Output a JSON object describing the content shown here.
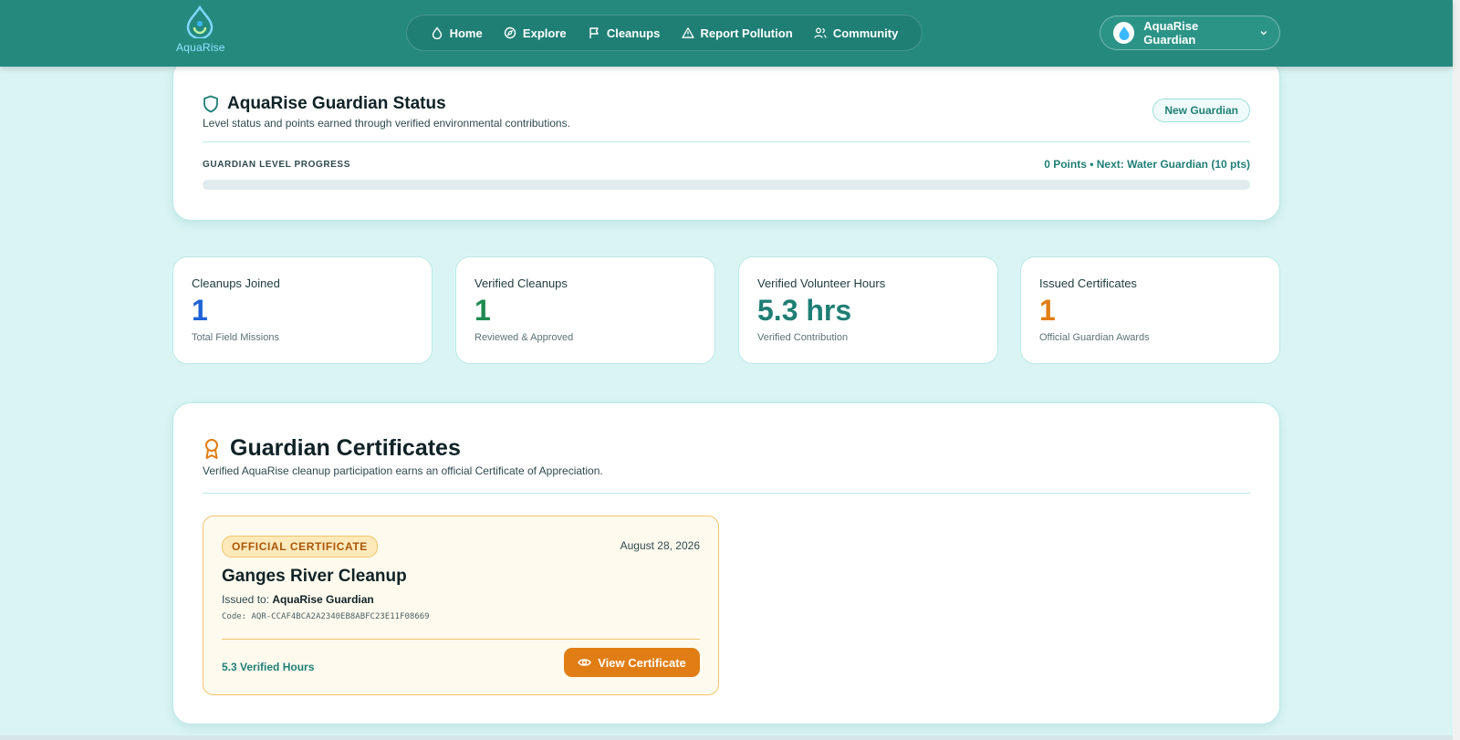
{
  "brand": {
    "name": "AquaRise"
  },
  "nav": {
    "items": [
      {
        "label": "Home",
        "icon": "droplet-icon"
      },
      {
        "label": "Explore",
        "icon": "compass-icon"
      },
      {
        "label": "Cleanups",
        "icon": "flag-icon"
      },
      {
        "label": "Report Pollution",
        "icon": "warning-triangle-icon"
      },
      {
        "label": "Community",
        "icon": "users-icon"
      }
    ]
  },
  "user": {
    "name": "AquaRise Guardian",
    "icon": "chevron-down-icon"
  },
  "status": {
    "title": "AquaRise Guardian Status",
    "subtitle": "Level status and points earned through verified environmental contributions.",
    "badge": "New Guardian",
    "progress_label": "GUARDIAN LEVEL PROGRESS",
    "progress_text": "0 Points • Next: Water Guardian (10 pts)",
    "progress_fraction": 0
  },
  "stats": [
    {
      "label": "Cleanups Joined",
      "value": "1",
      "caption": "Total Field Missions",
      "color": "#1e63d6"
    },
    {
      "label": "Verified Cleanups",
      "value": "1",
      "caption": "Reviewed & Approved",
      "color": "#1f8a52"
    },
    {
      "label": "Verified Volunteer Hours",
      "value": "5.3 hrs",
      "caption": "Verified Contribution",
      "color": "#1f7f75"
    },
    {
      "label": "Issued Certificates",
      "value": "1",
      "caption": "Official Guardian Awards",
      "color": "#e07d14"
    }
  ],
  "certificates": {
    "title": "Guardian Certificates",
    "subtitle": "Verified AquaRise cleanup participation earns an official Certificate of Appreciation.",
    "items": [
      {
        "badge": "OFFICIAL CERTIFICATE",
        "date": "August 28, 2026",
        "event": "Ganges River Cleanup",
        "issued_prefix": "Issued to:",
        "issued_to": "AquaRise Guardian",
        "code": "Code: AQR-CCAF4BCA2A2340EB8ABFC23E11F08669",
        "hours": "5.3 Verified Hours",
        "button": "View Certificate"
      }
    ]
  },
  "colors": {
    "header": "#25897e",
    "background": "#daf4f4",
    "accent_orange": "#e07d14"
  }
}
